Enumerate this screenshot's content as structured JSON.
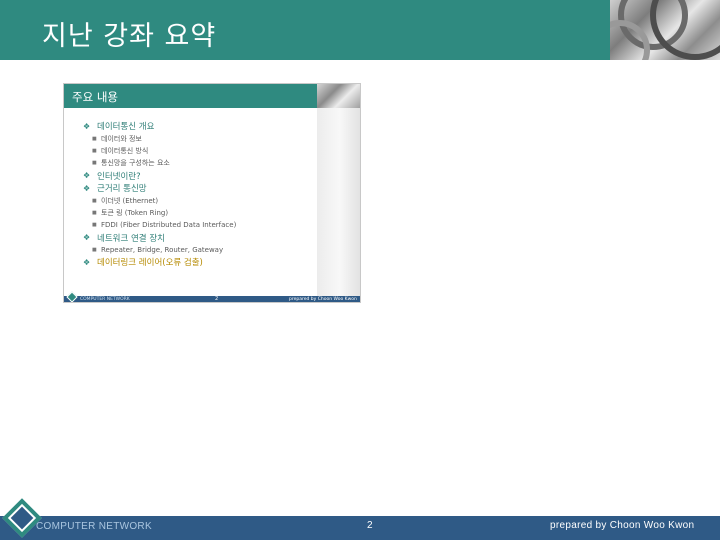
{
  "slide": {
    "title": "지난 강좌 요약"
  },
  "thumbnail": {
    "title": "주요 내용",
    "items": [
      {
        "level": 1,
        "marker": "❖",
        "text": "데이터통신 개요"
      },
      {
        "level": 2,
        "marker": "■",
        "text": "데이터와 정보"
      },
      {
        "level": 2,
        "marker": "■",
        "text": "데이터통신 방식"
      },
      {
        "level": 2,
        "marker": "■",
        "text": "통신망을 구성하는 요소"
      },
      {
        "level": 1,
        "marker": "❖",
        "text": "인터넷이란?"
      },
      {
        "level": 1,
        "marker": "❖",
        "text": "근거리 통신망"
      },
      {
        "level": 2,
        "marker": "■",
        "text": "이더넷 (Ethernet)"
      },
      {
        "level": 2,
        "marker": "■",
        "text": "토큰 링 (Token Ring)"
      },
      {
        "level": 2,
        "marker": "■",
        "text": "FDDI (Fiber Distributed Data Interface)"
      },
      {
        "level": 1,
        "marker": "❖",
        "text": "네트워크 연결 장치"
      },
      {
        "level": 2,
        "marker": "■",
        "text": "Repeater, Bridge, Router, Gateway"
      },
      {
        "level": 1,
        "marker": "❖",
        "text": "데이터링크 레이어(오류 검출)",
        "highlight": true
      }
    ],
    "footer": {
      "left": "COMPUTER NETWORK",
      "page": "2",
      "right": "prepared by Choon Woo Kwon"
    }
  },
  "footer": {
    "left": "COMPUTER NETWORK",
    "page": "2",
    "right": "prepared by Choon Woo Kwon"
  },
  "colors": {
    "teal": "#2f8a80",
    "navy": "#2f5a86",
    "highlight": "#b58a00"
  }
}
